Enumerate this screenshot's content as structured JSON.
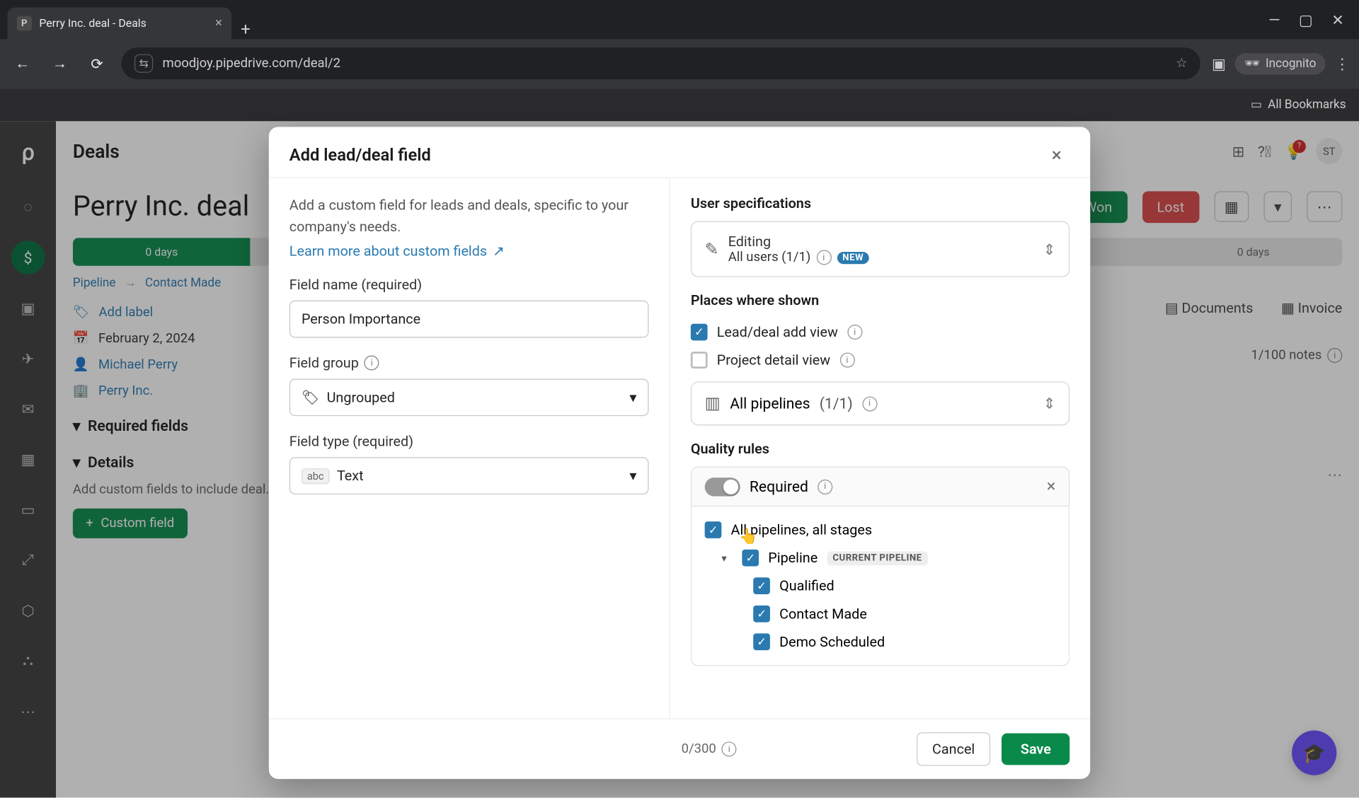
{
  "browser": {
    "tab_title": "Perry Inc. deal - Deals",
    "url": "moodjoy.pipedrive.com/deal/2",
    "incognito_label": "Incognito",
    "all_bookmarks": "All Bookmarks"
  },
  "app": {
    "section_title": "Deals",
    "deal_title": "Perry Inc. deal",
    "won": "Won",
    "lost": "Lost",
    "prog_left": "0 days",
    "prog_right": "0 days",
    "crumb1": "Pipeline",
    "crumb2": "Contact Made",
    "add_label": "Add label",
    "date": "February 2, 2024",
    "contact": "Michael Perry",
    "org": "Perry Inc.",
    "required_section": "Required fields",
    "details_section": "Details",
    "details_hint": "Add custom fields to include deal.",
    "custom_field_btn": "Custom field",
    "tab_docs": "Documents",
    "tab_invoice": "Invoice",
    "note_count": "1/100 notes",
    "user_initials": "ST",
    "bulb_count": "?"
  },
  "modal": {
    "title": "Add lead/deal field",
    "intro": "Add a custom field for leads and deals, specific to your company's needs.",
    "learn": "Learn more about custom fields",
    "field_name_label": "Field name (required)",
    "field_name_value": "Person Importance",
    "field_group_label": "Field group",
    "field_group_value": "Ungrouped",
    "field_type_label": "Field type (required)",
    "field_type_badge": "abc",
    "field_type_value": "Text",
    "user_spec_h": "User specifications",
    "editing_label": "Editing",
    "editing_users": "All users (1/1)",
    "new_pill": "NEW",
    "places_h": "Places where shown",
    "place_lead": "Lead/deal add view",
    "place_project": "Project detail view",
    "pipelines_label": "All pipelines",
    "pipelines_count": "(1/1)",
    "quality_h": "Quality rules",
    "required_label": "Required",
    "all_pipes": "All pipelines, all stages",
    "pipeline": "Pipeline",
    "current_pill": "CURRENT PIPELINE",
    "stage1": "Qualified",
    "stage2": "Contact Made",
    "stage3": "Demo Scheduled",
    "char_count": "0/300",
    "cancel": "Cancel",
    "save": "Save"
  }
}
